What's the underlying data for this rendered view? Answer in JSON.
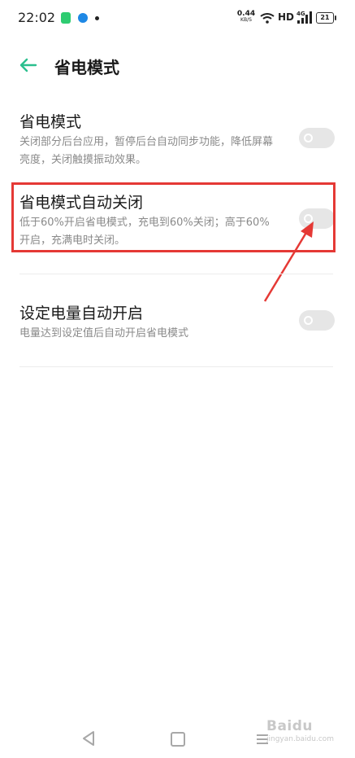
{
  "status_bar": {
    "time": "22:02",
    "net_speed": "0.44",
    "net_speed_unit": "KB/S",
    "hd_label": "HD",
    "signal_label": "4G",
    "battery_level": "21",
    "app_icon_colors": [
      "#2ecc71",
      "#1e88e5"
    ]
  },
  "header": {
    "back_icon": "back-arrow-icon",
    "title": "省电模式",
    "accent_color": "#2bbf8e"
  },
  "settings": [
    {
      "title": "省电模式",
      "description": "关闭部分后台应用，暂停后台自动同步功能，降低屏幕亮度，关闭触摸振动效果。",
      "enabled": false
    },
    {
      "title": "省电模式自动关闭",
      "description": "低于60%开启省电模式，充电到60%关闭；高于60%开启，充满电时关闭。",
      "enabled": false,
      "highlighted": true
    },
    {
      "title": "设定电量自动开启",
      "description": "电量达到设定值后自动开启省电模式",
      "enabled": false
    }
  ],
  "annotation": {
    "highlight_color": "#e53935"
  },
  "nav_bar": {
    "icons": [
      "nav-back-icon",
      "nav-home-icon",
      "nav-menu-icon"
    ]
  },
  "watermark": {
    "brand": "Baidu",
    "url": "jingyan.baidu.com"
  }
}
